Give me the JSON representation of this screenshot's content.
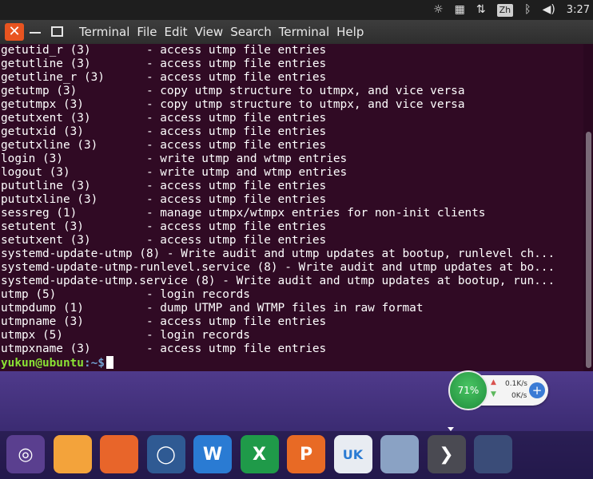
{
  "tray": {
    "lang": "Zh",
    "clock": "3:27"
  },
  "window": {
    "close_glyph": "✕",
    "menu": [
      "Terminal",
      "File",
      "Edit",
      "View",
      "Search",
      "Terminal",
      "Help"
    ]
  },
  "terminal": {
    "lines": [
      "getutid_r (3)        - access utmp file entries",
      "getutline (3)        - access utmp file entries",
      "getutline_r (3)      - access utmp file entries",
      "getutmp (3)          - copy utmp structure to utmpx, and vice versa",
      "getutmpx (3)         - copy utmp structure to utmpx, and vice versa",
      "getutxent (3)        - access utmp file entries",
      "getutxid (3)         - access utmp file entries",
      "getutxline (3)       - access utmp file entries",
      "login (3)            - write utmp and wtmp entries",
      "logout (3)           - write utmp and wtmp entries",
      "pututline (3)        - access utmp file entries",
      "pututxline (3)       - access utmp file entries",
      "sessreg (1)          - manage utmpx/wtmpx entries for non-init clients",
      "setutent (3)         - access utmp file entries",
      "setutxent (3)        - access utmp file entries",
      "systemd-update-utmp (8) - Write audit and utmp updates at bootup, runlevel ch...",
      "systemd-update-utmp-runlevel.service (8) - Write audit and utmp updates at bo...",
      "systemd-update-utmp.service (8) - Write audit and utmp updates at bootup, run...",
      "utmp (5)             - login records",
      "utmpdump (1)         - dump UTMP and WTMP files in raw format",
      "utmpname (3)         - access utmp file entries",
      "utmpx (5)            - login records",
      "utmpxname (3)        - access utmp file entries"
    ],
    "prompt_user": "yukun@ubuntu",
    "prompt_path": ":~$"
  },
  "netwidget": {
    "cpu": "71%",
    "up": "0.1K/s",
    "down": "0K/s",
    "plus": "+"
  },
  "dock": {
    "items": [
      {
        "name": "ubuntu-logo-icon",
        "glyph": "◎",
        "color": "#5a3f8f"
      },
      {
        "name": "files-icon",
        "glyph": "",
        "color": "#f3a33b"
      },
      {
        "name": "firefox-icon",
        "glyph": "",
        "color": "#e8652a"
      },
      {
        "name": "browser-icon",
        "glyph": "◯",
        "color": "#2f5a93"
      },
      {
        "name": "wps-writer-icon",
        "glyph": "W",
        "color": "#2a7bd3"
      },
      {
        "name": "wps-spreadsheet-icon",
        "glyph": "X",
        "color": "#1f9a49"
      },
      {
        "name": "wps-presentation-icon",
        "glyph": "P",
        "color": "#e86a25"
      },
      {
        "name": "ubuntu-kylin-store-icon",
        "glyph": "UK",
        "color": "#e8ecf2"
      },
      {
        "name": "software-center-icon",
        "glyph": "",
        "color": "#8aa2c4"
      },
      {
        "name": "terminal-icon",
        "glyph": "❯",
        "color": "#4a4a52"
      },
      {
        "name": "workspace-icon",
        "glyph": "",
        "color": "#3a4c78"
      }
    ]
  }
}
